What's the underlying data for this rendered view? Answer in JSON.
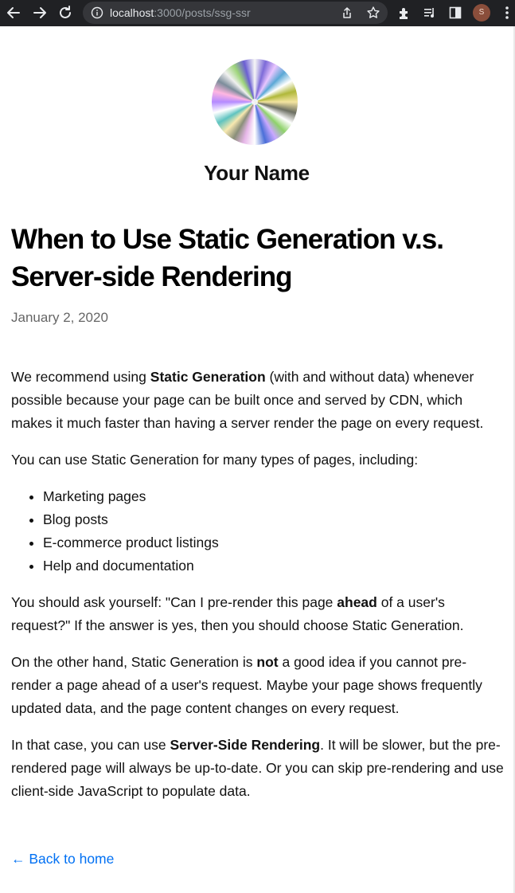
{
  "browser": {
    "url_host": "localhost",
    "url_path": ":3000/posts/ssg-ssr",
    "profile_initial": "S"
  },
  "page": {
    "author_name": "Your Name",
    "title": "When to Use Static Generation v.s. Server-side Rendering",
    "date": "January 2, 2020",
    "p1": {
      "before": "We recommend using ",
      "bold": "Static Generation",
      "after": " (with and without data) whenever possible because your page can be built once and served by CDN, which makes it much faster than having a server render the page on every request."
    },
    "p2": "You can use Static Generation for many types of pages, including:",
    "list": [
      "Marketing pages",
      "Blog posts",
      "E-commerce product listings",
      "Help and documentation"
    ],
    "p3": {
      "before": "You should ask yourself: \"Can I pre-render this page ",
      "bold": "ahead",
      "after": " of a user's request?\" If the answer is yes, then you should choose Static Generation."
    },
    "p4": {
      "before": "On the other hand, Static Generation is ",
      "bold": "not",
      "after": " a good idea if you cannot pre-render a page ahead of a user's request. Maybe your page shows frequently updated data, and the page content changes on every request."
    },
    "p5": {
      "before": "In that case, you can use ",
      "bold": "Server-Side Rendering",
      "after": ". It will be slower, but the pre-rendered page will always be up-to-date. Or you can skip pre-rendering and use client-side JavaScript to populate data."
    },
    "back_link": "← Back to home"
  }
}
